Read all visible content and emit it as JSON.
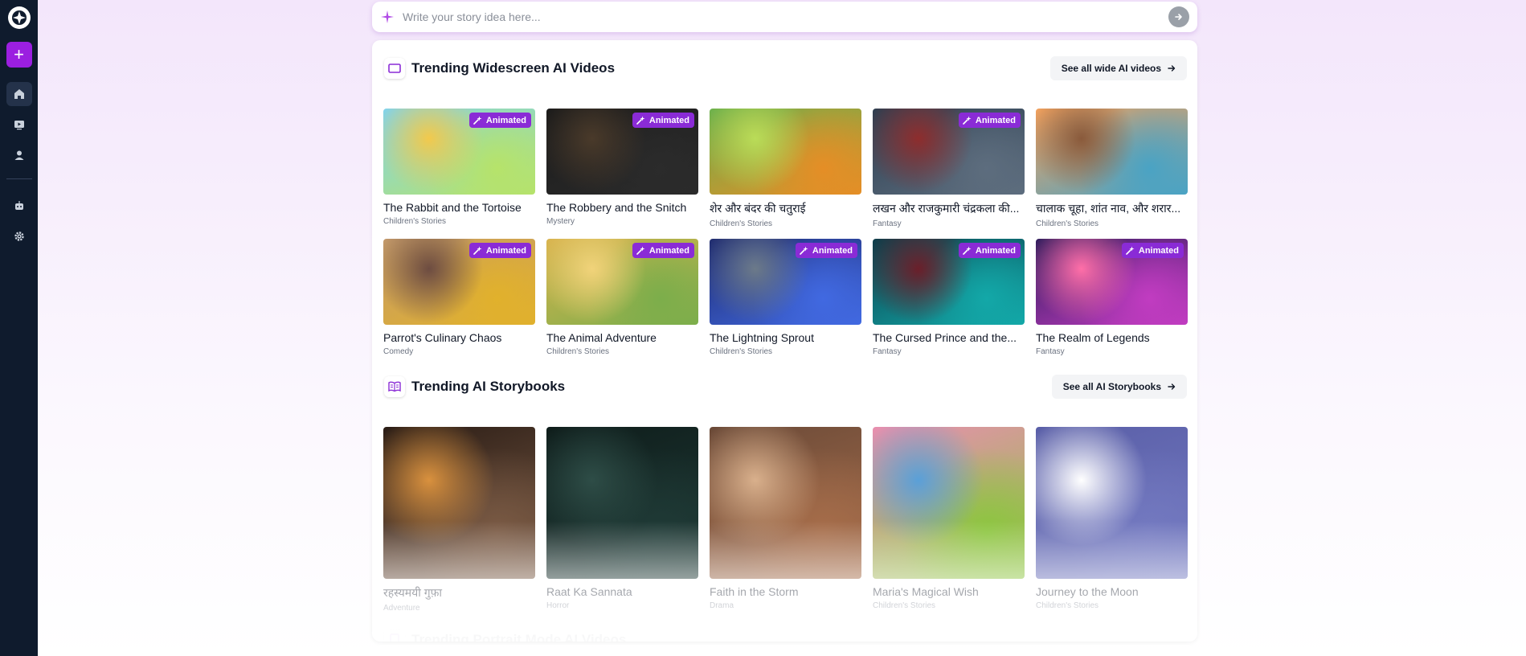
{
  "search": {
    "placeholder": "Write your story idea here..."
  },
  "sidebar": {
    "items": [
      {
        "name": "home-icon"
      },
      {
        "name": "videos-icon"
      },
      {
        "name": "profile-icon"
      },
      {
        "name": "bot-icon"
      },
      {
        "name": "gear-icon"
      }
    ]
  },
  "sections": {
    "widescreen": {
      "title": "Trending Widescreen AI Videos",
      "see_all": "See all wide AI videos",
      "badge": "Animated",
      "cards": [
        {
          "title": "The Rabbit and the Tortoise",
          "genre": "Children's Stories",
          "animated": true,
          "colors": [
            "#7fd3f0",
            "#b6e36a",
            "#f2c94c"
          ]
        },
        {
          "title": "The Robbery and the Snitch",
          "genre": "Mystery",
          "animated": true,
          "colors": [
            "#1a1a1a",
            "#2b2b2b",
            "#4a3a2a"
          ]
        },
        {
          "title": "शेर और बंदर की चतुराई",
          "genre": "Children's Stories",
          "animated": false,
          "colors": [
            "#6ab04c",
            "#e58e26",
            "#badc58"
          ]
        },
        {
          "title": "लखन और राजकुमारी चंद्रकला की...",
          "genre": "Fantasy",
          "animated": true,
          "colors": [
            "#2c3e50",
            "#5d6d7e",
            "#8e2d2d"
          ]
        },
        {
          "title": "चालाक चूहा, शांत नाव, और शरार...",
          "genre": "Children's Stories",
          "animated": false,
          "colors": [
            "#f5a25d",
            "#4aa3c4",
            "#8a5a3b"
          ]
        },
        {
          "title": "Parrot's Culinary Chaos",
          "genre": "Comedy",
          "animated": true,
          "colors": [
            "#c49a6c",
            "#e1b12c",
            "#6d4c41"
          ]
        },
        {
          "title": "The Animal Adventure",
          "genre": "Children's Stories",
          "animated": true,
          "colors": [
            "#d9b34d",
            "#7cae4b",
            "#f1d37a"
          ]
        },
        {
          "title": "The Lightning Sprout",
          "genre": "Children's Stories",
          "animated": true,
          "colors": [
            "#1e2a6e",
            "#4169e1",
            "#6c7a89"
          ]
        },
        {
          "title": "The Cursed Prince and the...",
          "genre": "Fantasy",
          "animated": true,
          "colors": [
            "#0b3d4a",
            "#13a8a8",
            "#6b1f2a"
          ]
        },
        {
          "title": "The Realm of Legends",
          "genre": "Fantasy",
          "animated": true,
          "colors": [
            "#2b1b5a",
            "#c13cc1",
            "#ff6fa8"
          ]
        }
      ]
    },
    "storybooks": {
      "title": "Trending AI Storybooks",
      "see_all": "See all AI Storybooks",
      "cards": [
        {
          "title": "रहस्यमयी गुफ़ा",
          "genre": "Adventure",
          "colors": [
            "#2b1d16",
            "#7a5a44",
            "#d9913e"
          ]
        },
        {
          "title": "Raat Ka Sannata",
          "genre": "Horror",
          "colors": [
            "#0f1d1b",
            "#1f3a36",
            "#2e4d47"
          ]
        },
        {
          "title": "Faith in the Storm",
          "genre": "Drama",
          "colors": [
            "#6b4a38",
            "#a66d4a",
            "#d9b08c"
          ]
        },
        {
          "title": "Maria's Magical Wish",
          "genre": "Children's Stories",
          "colors": [
            "#e88fb0",
            "#8cc63f",
            "#5aa0d8"
          ]
        },
        {
          "title": "Journey to the Moon",
          "genre": "Children's Stories",
          "colors": [
            "#5a5fa8",
            "#7379c0",
            "#ffffff"
          ]
        }
      ]
    },
    "portrait": {
      "title": "Trending Portrait Mode AI Videos"
    }
  },
  "colors": {
    "sidebar": "#0f1b2d",
    "accent": "#9b1fe0",
    "badge": "#8a2bd6"
  }
}
